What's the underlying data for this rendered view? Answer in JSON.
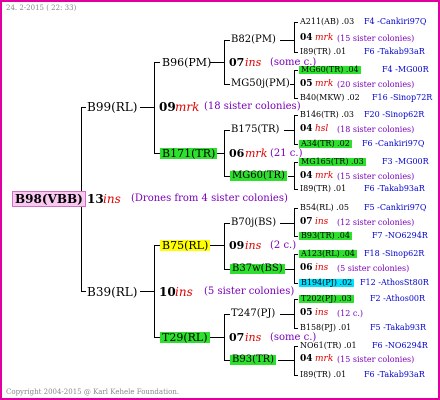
{
  "header": {
    "date_text": "24. 2-2015 ( 22: 33)"
  },
  "footer": {
    "copyright": "Copyright 2004-2015 @ Karl Kehele Foundation."
  },
  "root": {
    "name": "B98(VBB)",
    "year": "13",
    "mark": "ins",
    "note": "(Drones from 4 sister colonies)"
  },
  "gen1": {
    "top": {
      "name": "B99(RL)",
      "year": "09",
      "mark": "mrk",
      "note": "(18 sister colonies)"
    },
    "bottom": {
      "name": "B39(RL)",
      "year": "10",
      "mark": "ins",
      "note": "(5 sister colonies)"
    }
  },
  "gen2": {
    "a": {
      "name": "B96(PM)",
      "year": "07",
      "mark": "ins",
      "note": "(some c.)"
    },
    "b": {
      "name": "B171(TR)",
      "year": "06",
      "mark": "mrk",
      "note": "(21 c.)"
    },
    "c": {
      "name": "B75(RL)",
      "year": "09",
      "mark": "ins",
      "note": "(2 c.)"
    },
    "d": {
      "name": "T29(RL)",
      "year": "07",
      "mark": "ins",
      "note": "(some c.)"
    }
  },
  "gen3": {
    "a1": {
      "name": "B82(PM)",
      "year": "04",
      "mark": "mrk",
      "note": "(15 sister colonies)"
    },
    "a2": {
      "name": "MG50j(PM)",
      "year": "05",
      "mark": "mrk",
      "note": "(20 sister colonies)"
    },
    "b1": {
      "name": "B175(TR)",
      "year": "04",
      "mark": "hsl",
      "note": "(18 sister colonies)"
    },
    "b2": {
      "name": "MG60(TR)",
      "year": "04",
      "mark": "mrk",
      "note": "(15 sister colonies)"
    },
    "c1": {
      "name": "B70j(BS)",
      "year": "07",
      "mark": "ins",
      "note": "(12 sister colonies)"
    },
    "c2": {
      "name": "B37w(BS)",
      "year": "06",
      "mark": "ins",
      "note": "(5 sister colonies)"
    },
    "d1": {
      "name": "T247(PJ)",
      "year": "05",
      "mark": "ins",
      "note": "(12 c.)"
    },
    "d2": {
      "name": "B93(TR)",
      "year": "04",
      "mark": "mrk",
      "note": "(15 sister colonies)"
    }
  },
  "gen4": {
    "a1t": {
      "name": "A211(AB) .03",
      "loc": "F4 -Cankiri97Q"
    },
    "a1b": {
      "name": "I89(TR) .01",
      "loc": "F6 -Takab93aR"
    },
    "a2t": {
      "name": "MG60(TR) .04",
      "loc": "F4 -MG00R"
    },
    "a2b": {
      "name": "B40(MKW) .02",
      "loc": "F16 -Sinop72R"
    },
    "b1t": {
      "name": "B146(TR) .03",
      "loc": "F20 -Sinop62R"
    },
    "b1b": {
      "name": "A34(TR) .02",
      "loc": "F6 -Cankiri97Q"
    },
    "b2t": {
      "name": "MG165(TR) .03",
      "loc": "F3 -MG00R"
    },
    "b2b": {
      "name": "I89(TR) .01",
      "loc": "F6 -Takab93aR"
    },
    "c1t": {
      "name": "B54(RL) .05",
      "loc": "F5 -Cankiri97Q"
    },
    "c1b": {
      "name": "B93(TR) .04",
      "loc": "F7 -NO6294R"
    },
    "c2t": {
      "name": "A123(RL) .04",
      "loc": "F18 -Sinop62R"
    },
    "c2b": {
      "name": "B194(PJ) .02",
      "loc": "F12 -AthosSt80R"
    },
    "d1t": {
      "name": "T202(PJ) .03",
      "loc": "F2 -Athos00R"
    },
    "d1b": {
      "name": "B158(PJ) .01",
      "loc": "F5 -Takab93R"
    },
    "d2t": {
      "name": "NO61(TR) .01",
      "loc": "F6 -NO6294R"
    },
    "d2b": {
      "name": "I89(TR) .01",
      "loc": "F6 -Takab93aR"
    }
  }
}
